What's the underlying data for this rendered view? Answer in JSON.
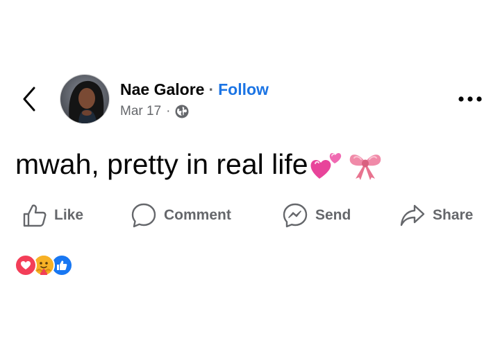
{
  "header": {
    "author_name": "Nae Galore",
    "separator": "·",
    "follow_label": "Follow",
    "date": "Mar 17",
    "meta_separator": "·",
    "audience_icon": "globe-icon",
    "back_icon": "chevron-left-icon",
    "more_icon": "more-horizontal-icon"
  },
  "post": {
    "text": "mwah, pretty in real life",
    "emojis": [
      "two-hearts-emoji",
      "ribbon-emoji"
    ]
  },
  "actions": {
    "like_label": "Like",
    "comment_label": "Comment",
    "send_label": "Send",
    "share_label": "Share"
  },
  "reactions": [
    "love-reaction",
    "care-reaction",
    "like-reaction"
  ],
  "colors": {
    "follow": "#1b74e4",
    "secondary_text": "#65676b",
    "primary_text": "#050505",
    "love": "#f33e58",
    "like": "#1877f2",
    "care": "#f7b125"
  }
}
